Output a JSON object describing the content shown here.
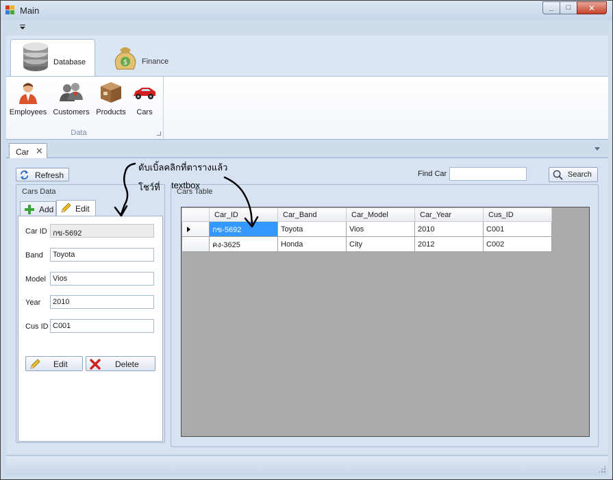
{
  "window": {
    "title": "Main"
  },
  "ribbon": {
    "tabs": [
      {
        "label": "Database",
        "icon": "database-icon",
        "active": true
      },
      {
        "label": "Finance",
        "icon": "money-bag-icon",
        "active": false
      }
    ],
    "group": {
      "label": "Data",
      "buttons": [
        {
          "label": "Employees",
          "icon": "employee-icon"
        },
        {
          "label": "Customers",
          "icon": "customers-icon"
        },
        {
          "label": "Products",
          "icon": "products-box-icon"
        },
        {
          "label": "Cars",
          "icon": "car-icon"
        }
      ]
    }
  },
  "doc_tab": {
    "label": "Car",
    "close": "✕"
  },
  "toolbar": {
    "refresh_label": "Refresh",
    "find_label": "Find Car",
    "find_value": "",
    "search_label": "Search"
  },
  "cars_data": {
    "title": "Cars Data",
    "tabs": {
      "add": "Add",
      "edit": "Edit"
    },
    "fields": {
      "car_id": {
        "label": "Car ID",
        "value": "กข-5692"
      },
      "band": {
        "label": "Band",
        "value": "Toyota"
      },
      "model": {
        "label": "Model",
        "value": "Vios"
      },
      "year": {
        "label": "Year",
        "value": "2010"
      },
      "cus_id": {
        "label": "Cus ID",
        "value": "C001"
      }
    },
    "buttons": {
      "edit": "Edit",
      "delete": "Delete"
    }
  },
  "cars_table": {
    "title": "Cars Table",
    "columns": [
      "Car_ID",
      "Car_Band",
      "Car_Model",
      "Car_Year",
      "Cus_ID"
    ],
    "rows": [
      [
        "กข-5692",
        "Toyota",
        "Vios",
        "2010",
        "C001"
      ],
      [
        "คง-3625",
        "Honda",
        "City",
        "2012",
        "C002"
      ]
    ]
  },
  "annotations": {
    "line1": "ดับเบิ้ลคลิกที่ตารางแล้ว",
    "line2": "โชว์ที่",
    "line3": "textbox"
  },
  "colors": {
    "selection": "#3399ff",
    "window_bg": "#cfdcec"
  }
}
